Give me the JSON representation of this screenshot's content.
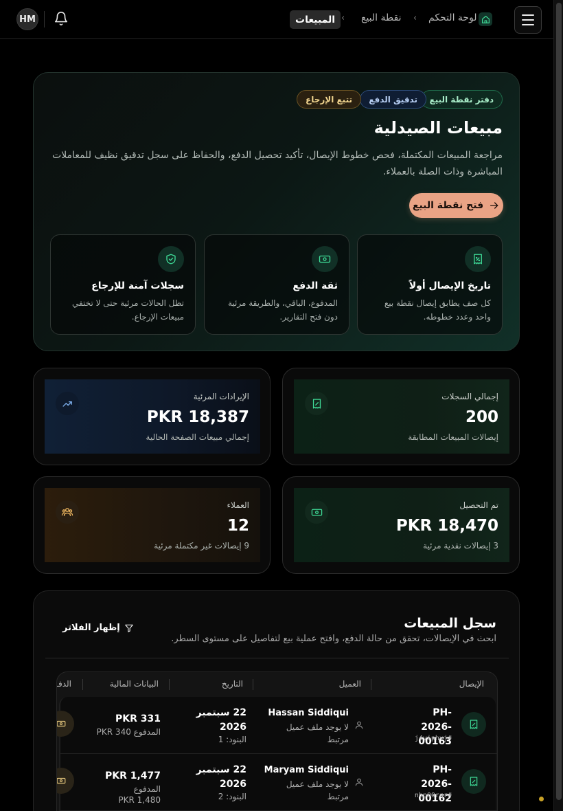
{
  "header": {
    "avatar_initials": "HM",
    "breadcrumb": {
      "home": "لوحة التحكم",
      "pos": "نقطة البيع",
      "current": "المبيعات"
    }
  },
  "hero": {
    "tags": [
      "دفتر نقطة البيع",
      "تدقيق الدفع",
      "تتبع الإرجاع"
    ],
    "title": "مبيعات الصيدلية",
    "description": "مراجعة المبيعات المكتملة، فحص خطوط الإيصال، تأكيد تحصيل الدفع، والحفاظ على سجل تدقيق نظيف للمعاملات المباشرة وذات الصلة بالعملاء.",
    "open_pos_button": "فتح نقطة البيع",
    "features": [
      {
        "title": "تاريخ الإيصال أولاً",
        "desc": "كل صف يطابق إيصال نقطة بيع واحد وعدد خطوطه.",
        "icon": "receipt-icon"
      },
      {
        "title": "ثقة الدفع",
        "desc": "المدفوع، الباقي، والطريقة مرئية دون فتح التقارير.",
        "icon": "cash-icon"
      },
      {
        "title": "سجلات آمنة للإرجاع",
        "desc": "تظل الحالات مرئية حتى لا تختفي مبيعات الإرجاع.",
        "icon": "shield-check-icon"
      }
    ]
  },
  "stats": {
    "total_records": {
      "label": "إجمالي السجلات",
      "value": "200",
      "sub": "إيصالات المبيعات المطابقة",
      "icon": "receipt-icon"
    },
    "visible_revenue": {
      "label": "الإيرادات المرئية",
      "value": "PKR 18,387",
      "sub": "إجمالي مبيعات الصفحة الحالية",
      "icon": "trending-up-icon"
    },
    "collected": {
      "label": "تم التحصيل",
      "value": "PKR 18,470",
      "sub": "3 إيصالات نقدية مرئية",
      "icon": "cash-icon"
    },
    "customers": {
      "label": "العملاء",
      "value": "12",
      "sub": "9 إيصالات غير مكتملة مرئية",
      "icon": "users-icon"
    }
  },
  "sales_log": {
    "title": "سجل المبيعات",
    "description": "ابحث في الإيصالات، تحقق من حالة الدفع، وافتح عملية بيع لتفاصيل على مستوى السطر.",
    "filters_button": "إظهار الفلاتر",
    "columns": [
      "الإيصال",
      "العميل",
      "التاريخ",
      "البيانات المالية",
      "الدفـ"
    ],
    "rows": [
      {
        "receipt_no": "PH-2026-00163",
        "code": "j4viphvj#",
        "customer": "Hassan Siddiqui",
        "customer_note": "لا يوجد ملف عميل مرتبط",
        "date": "22 سبتمبر 2026",
        "items": "البنود: 1",
        "amount": "PKR 331",
        "paid_label": "المدفوع",
        "paid_value": "PKR 340",
        "paid_inline": true
      },
      {
        "receipt_no": "PH-2026-00162",
        "code": "nbp00rqr#",
        "customer": "Maryam Siddiqui",
        "customer_note": "لا يوجد ملف عميل مرتبط",
        "date": "22 سبتمبر 2026",
        "items": "البنود: 2",
        "amount": "PKR 1,477",
        "paid_label": "المدفوع",
        "paid_value": "PKR 1,480",
        "paid_inline": false
      }
    ]
  },
  "colors": {
    "accent_button": "#eaa385",
    "accent_green": "#2fd38a",
    "page_bg": "#000000"
  }
}
